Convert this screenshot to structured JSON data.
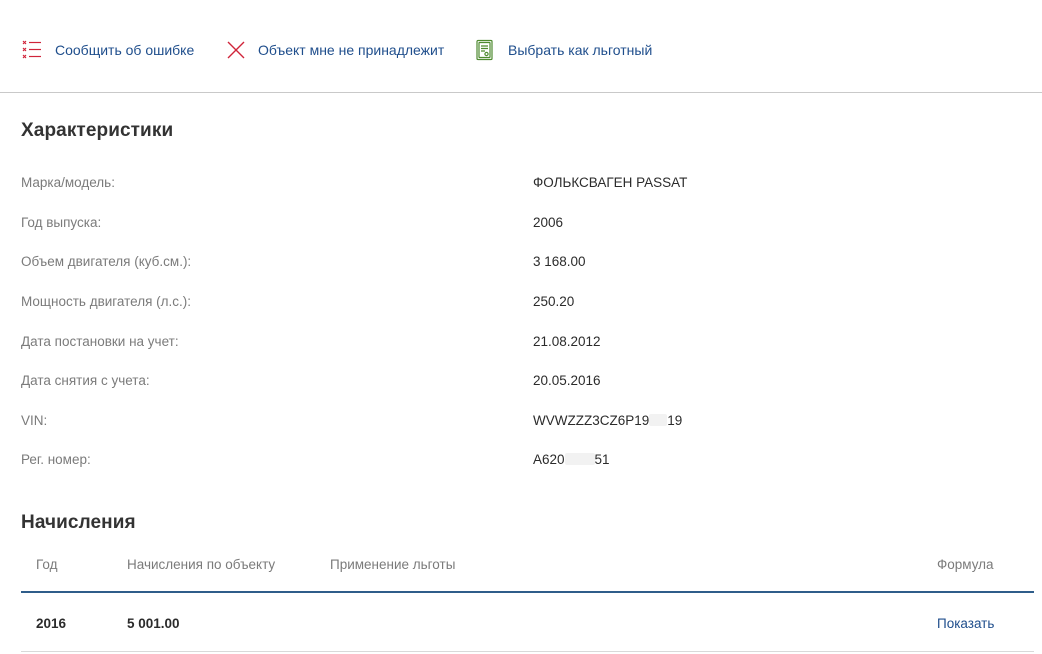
{
  "actions": {
    "report_error": "Сообщить об ошибке",
    "not_mine": "Объект мне не принадлежит",
    "choose_benefit": "Выбрать как льготный"
  },
  "colors": {
    "link": "#1f4e8c",
    "error_red": "#d0243a",
    "benefit_green": "#4e8a2f",
    "table_rule": "#2f5d8a"
  },
  "icons": {
    "report_error": "error-list-icon",
    "not_mine": "close-cross-icon",
    "choose_benefit": "document-certificate-icon"
  },
  "characteristics": {
    "title": "Характеристики",
    "rows": [
      {
        "key": "Марка/модель:",
        "value": "ФОЛЬКСВАГЕН PASSAT"
      },
      {
        "key": "Год выпуска:",
        "value": "2006"
      },
      {
        "key": "Объем двигателя (куб.см.):",
        "value": "3 168.00"
      },
      {
        "key": "Мощность двигателя (л.с.):",
        "value": "250.20"
      },
      {
        "key": "Дата постановки на учет:",
        "value": "21.08.2012"
      },
      {
        "key": "Дата снятия с учета:",
        "value": "20.05.2016"
      },
      {
        "key": "VIN:",
        "value": "WVWZZZ3CZ6P19",
        "value_tail": "19"
      },
      {
        "key": "Рег. номер:",
        "value": "А620",
        "value_tail": "51"
      }
    ]
  },
  "charges": {
    "title": "Начисления",
    "columns": {
      "year": "Год",
      "charge": "Начисления по объекту",
      "benefit": "Применение льготы",
      "formula": "Формула"
    },
    "rows": [
      {
        "year": "2016",
        "charge": "5 001.00",
        "benefit": "",
        "formula": "Показать"
      }
    ]
  }
}
